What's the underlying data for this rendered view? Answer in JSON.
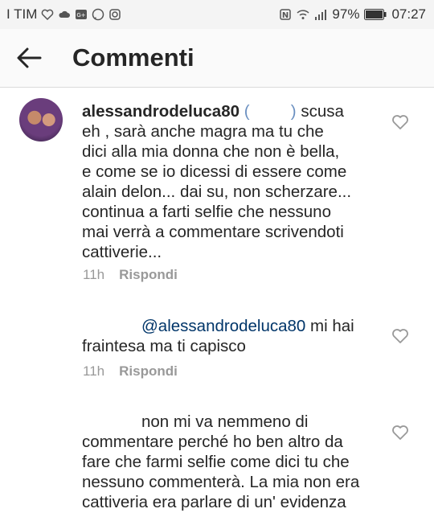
{
  "status_bar": {
    "carrier": "I TIM",
    "battery": "97%",
    "time": "07:27"
  },
  "header": {
    "title": "Commenti"
  },
  "comments": [
    {
      "username": "alessandrodeluca80",
      "lines": [
        "scusa",
        "eh , sarà anche magra ma tu che",
        "dici alla mia donna che non è bella,",
        "e come se io dicessi di essere come",
        "alain delon... dai su, non scherzare...",
        "continua a farti selfie che nessuno",
        "mai verrà a commentare scrivendoti",
        "cattiverie..."
      ],
      "time": "11h",
      "reply_label": "Rispondi"
    },
    {
      "mention": "@alessandrodeluca80",
      "lines": [
        "mi hai",
        "fraintesa ma ti capisco"
      ],
      "time": "11h",
      "reply_label": "Rispondi"
    },
    {
      "lines": [
        "non mi va nemmeno di",
        "commentare perché ho ben altro da",
        "fare che farmi selfie come dici tu che",
        "nessuno commenterà. La mia non era",
        "cattiveria era parlare di un' evidenza"
      ]
    }
  ]
}
